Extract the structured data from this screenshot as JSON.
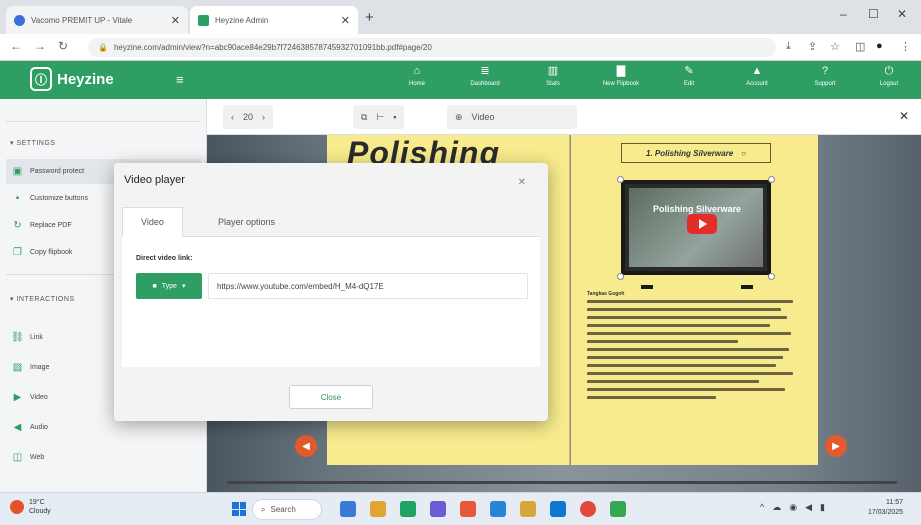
{
  "browser": {
    "tabs": [
      {
        "title": "Vacomo PREMIT UP - Vitale",
        "favicon_color": "#3c6fd8"
      },
      {
        "title": "Heyzine Admin",
        "favicon_color": "#2e9e63"
      }
    ],
    "new_tab": "+",
    "window": {
      "minimize": "–",
      "maximize": "☐",
      "close": "✕"
    },
    "nav": {
      "back": "←",
      "forward": "→",
      "reload": "↻"
    },
    "url": "heyzine.com/admin/view?n=abc90ace84e29b7f724638578745932701091bb.pdf#page/20",
    "toolbar_icons": [
      "download-icon",
      "share-icon",
      "star-icon",
      "sidepanel-icon",
      "profile-icon",
      "menu-icon"
    ]
  },
  "app": {
    "logo_mark": "Ⓘ",
    "logo_text": "Heyzine",
    "hamburger": "≡",
    "nav": [
      {
        "label": "Home",
        "icon": "⌂"
      },
      {
        "label": "Dashboard",
        "icon": "≣"
      },
      {
        "label": "Stats",
        "icon": "▥"
      },
      {
        "label": "New Flipbook",
        "icon": "▇"
      },
      {
        "label": "Edit",
        "icon": "✎"
      },
      {
        "label": "Account",
        "icon": "▲"
      },
      {
        "label": "Support",
        "icon": "?"
      },
      {
        "label": "Logout",
        "icon": "⏻"
      }
    ]
  },
  "sidebar": {
    "settings_header": "SETTINGS",
    "settings_items": [
      {
        "label": "Password protect",
        "icon": "▣"
      },
      {
        "label": "Customize buttons",
        "icon": "▪"
      },
      {
        "label": "Replace PDF",
        "icon": "↻"
      },
      {
        "label": "Copy flipbook",
        "icon": "❐"
      }
    ],
    "interactions_header": "INTERACTIONS",
    "interaction_items": [
      {
        "label": "Link",
        "icon": "⛓"
      },
      {
        "label": "Image",
        "icon": "▨"
      },
      {
        "label": "Video",
        "icon": "▶"
      },
      {
        "label": "Audio",
        "icon": "◀"
      },
      {
        "label": "Web",
        "icon": "◫"
      }
    ]
  },
  "editor": {
    "prev": "‹",
    "page": "20",
    "next": "›",
    "tools": [
      "⧉",
      "⊢",
      "▪"
    ],
    "media_icon": "⊕",
    "media_label": "Video",
    "close": "✕"
  },
  "book": {
    "left_title": "Polishing",
    "right_section": "1. Polishing Silverware",
    "video_title": "Polishing Silverware",
    "references_label": "Tangkas Gogoh"
  },
  "modal": {
    "title": "Video player",
    "close_icon": "✕",
    "tabs": [
      "Video",
      "Player options"
    ],
    "link_label": "Direct video link:",
    "type_label": "Type",
    "video_url": "https://www.youtube.com/embed/H_M4-dQ17E",
    "close_button": "Close"
  },
  "taskbar": {
    "weather_temp": "19°C",
    "weather_desc": "Cloudy",
    "search": "Search",
    "time": "11:57",
    "date": "17/03/2025",
    "app_colors": [
      "#3a7bd5",
      "#e1a534",
      "#1fa463",
      "#6b5bd6",
      "#e8583a",
      "#2b83d6",
      "#d8a63a",
      "#0f77d4",
      "#e24a3b",
      "#34a853"
    ]
  }
}
